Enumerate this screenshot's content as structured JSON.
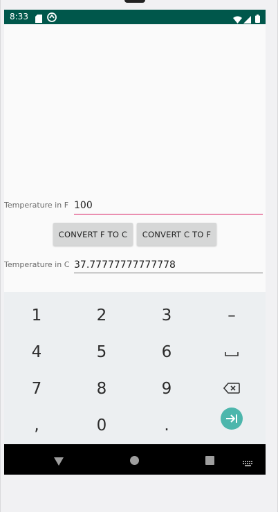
{
  "status_bar": {
    "time": "8:33",
    "background": "#00574b",
    "left_icons": [
      "sd-card-icon",
      "sync-circle-icon"
    ],
    "right_icons": [
      "wifi-icon",
      "cell-signal-icon",
      "battery-icon"
    ]
  },
  "form": {
    "fahrenheit_label": "Temperature in F",
    "fahrenheit_value": "100",
    "celsius_label": "Temperature in C",
    "celsius_value": "37.77777777777778"
  },
  "buttons": {
    "f_to_c": "CONVERT F TO C",
    "c_to_f": "CONVERT C TO F"
  },
  "keyboard": {
    "rows": [
      [
        "1",
        "2",
        "3",
        "–"
      ],
      [
        "4",
        "5",
        "6",
        "space"
      ],
      [
        "7",
        "8",
        "9",
        "backspace"
      ],
      [
        ",",
        "0",
        ".",
        "next"
      ]
    ],
    "row1": {
      "k1": "1",
      "k2": "2",
      "k3": "3",
      "k4": "–"
    },
    "row2": {
      "k1": "4",
      "k2": "5",
      "k3": "6"
    },
    "row3": {
      "k1": "7",
      "k2": "8",
      "k3": "9"
    },
    "row4": {
      "k1": ",",
      "k2": "0",
      "k3": "."
    },
    "accent_color": "#4db6ac"
  },
  "nav_bar": {
    "items": [
      "back-icon",
      "home-icon",
      "recents-icon",
      "keyboard-switch-icon"
    ]
  },
  "colors": {
    "active_underline": "#d81b60",
    "button_background": "#d6d7d7",
    "keyboard_background": "#eceff1"
  }
}
